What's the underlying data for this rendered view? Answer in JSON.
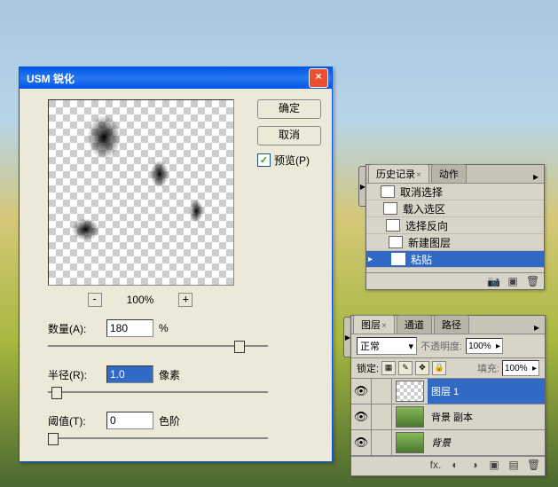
{
  "dialog": {
    "title": "USM 锐化",
    "ok": "确定",
    "cancel": "取消",
    "preview_label": "预览(P)",
    "zoom": "100%",
    "amount_label": "数量(A):",
    "amount_value": "180",
    "amount_unit": "%",
    "radius_label": "半径(R):",
    "radius_value": "1.0",
    "radius_unit": "像素",
    "threshold_label": "阈值(T):",
    "threshold_value": "0",
    "threshold_unit": "色阶"
  },
  "history": {
    "tab1": "历史记录",
    "tab2": "动作",
    "items": [
      {
        "label": "取消选择"
      },
      {
        "label": "载入选区"
      },
      {
        "label": "选择反向"
      },
      {
        "label": "新建图层"
      },
      {
        "label": "粘贴",
        "selected": true
      }
    ]
  },
  "layers": {
    "tab1": "图层",
    "tab2": "通道",
    "tab3": "路径",
    "blend": "正常",
    "opacity_label": "不透明度:",
    "opacity_value": "100%",
    "lock_label": "锁定:",
    "fill_label": "填充:",
    "fill_value": "100%",
    "items": [
      {
        "name": "图层 1",
        "selected": true,
        "thumb": "checker"
      },
      {
        "name": "背景 副本",
        "thumb": "img"
      },
      {
        "name": "背景",
        "thumb": "img",
        "italic": true
      }
    ]
  }
}
